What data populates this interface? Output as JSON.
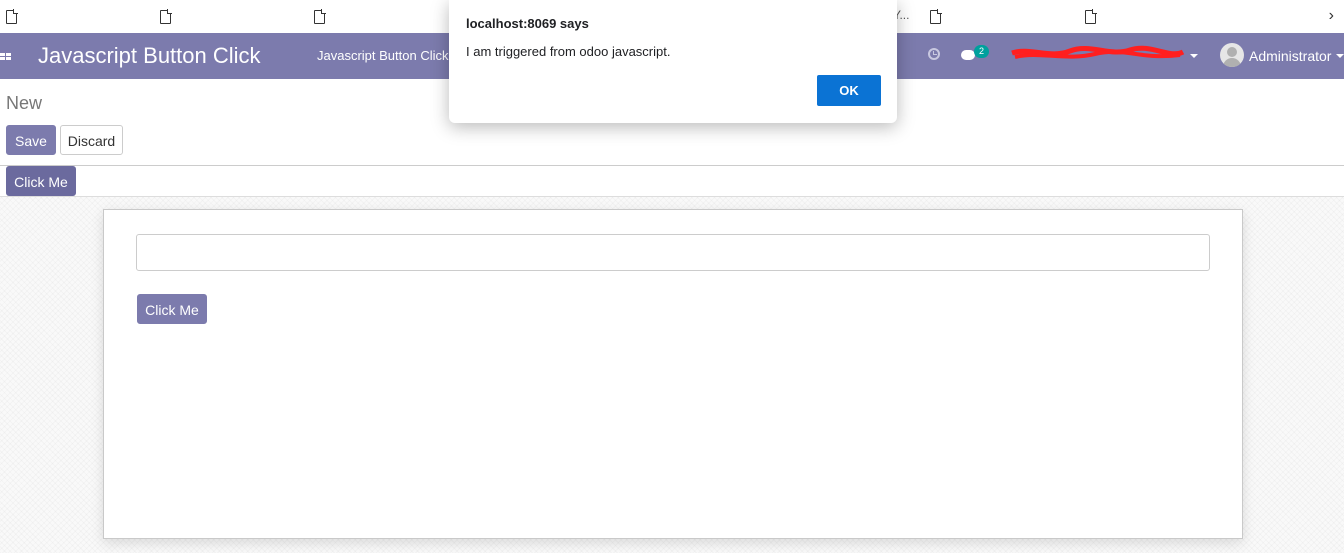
{
  "bookmarks": {
    "truncated_text": "Y...",
    "more_label": "›"
  },
  "navbar": {
    "app_title": "Javascript Button Click",
    "menu_item": "Javascript Button Click",
    "messages_count": "2",
    "user_name": "Administrator",
    "color": "#7c7bad"
  },
  "control_panel": {
    "breadcrumb": "New",
    "save_label": "Save",
    "discard_label": "Discard"
  },
  "statusbar": {
    "click_me_label": "Click Me"
  },
  "sheet": {
    "input_value": "",
    "click_me_label": "Click Me"
  },
  "dialog": {
    "title": "localhost:8069 says",
    "message": "I am triggered from odoo javascript.",
    "ok_label": "OK",
    "ok_color": "#0b73d4"
  }
}
